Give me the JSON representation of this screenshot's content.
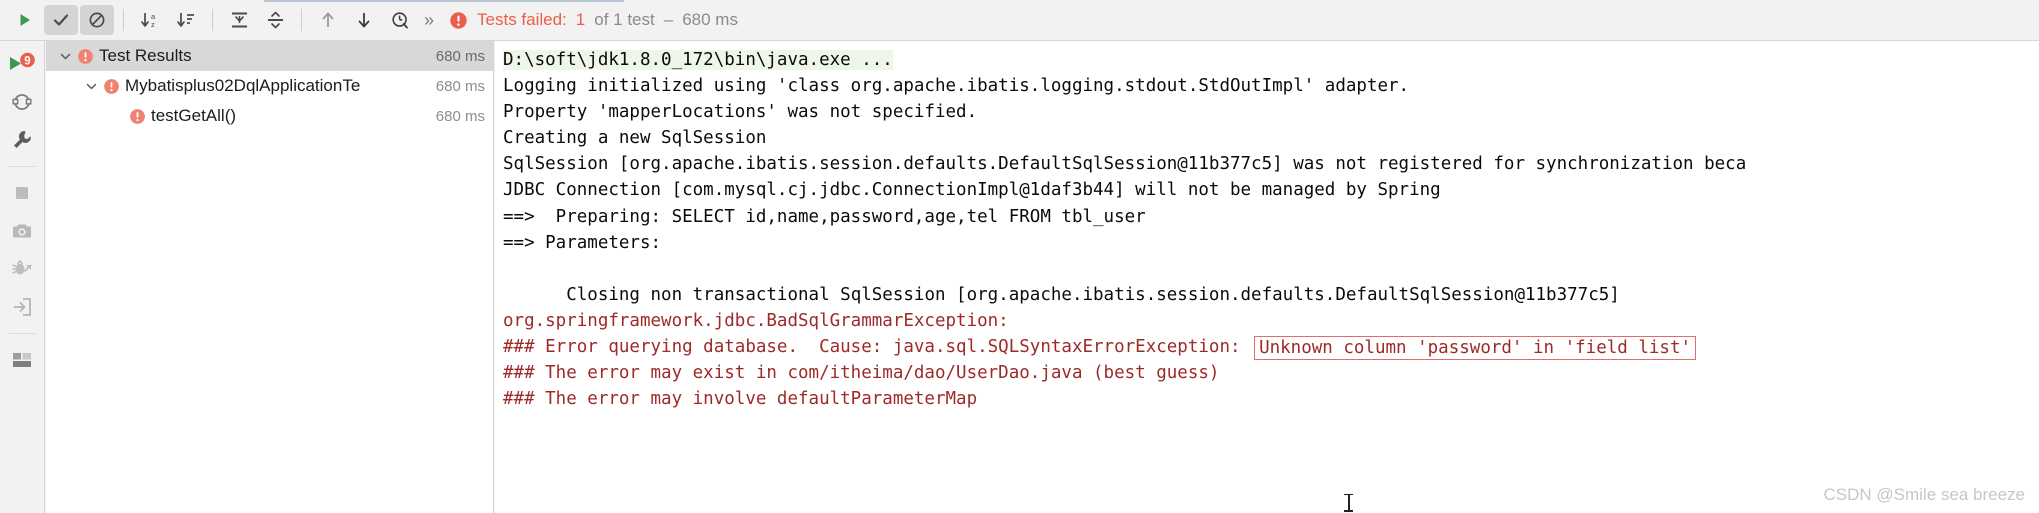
{
  "toolbar": {
    "buttons": [
      {
        "name": "rerun-tests-button",
        "icon": "play-icon",
        "label": "Rerun Tests",
        "pressed": false
      },
      {
        "name": "show-passed-button",
        "icon": "check-icon",
        "label": "Show Passed",
        "pressed": true
      },
      {
        "name": "show-ignored-button",
        "icon": "ignore-icon",
        "label": "Show Ignored",
        "pressed": true
      },
      {
        "name": "sort-alphabetically-button",
        "icon": "sort-alpha-icon",
        "label": "Sort Alphabetically",
        "pressed": false
      },
      {
        "name": "sort-by-duration-button",
        "icon": "sort-duration-icon",
        "label": "Sort by Duration",
        "pressed": false
      },
      {
        "name": "expand-all-button",
        "icon": "expand-all-icon",
        "label": "Expand All",
        "pressed": false
      },
      {
        "name": "collapse-all-button",
        "icon": "collapse-all-icon",
        "label": "Collapse All",
        "pressed": false
      },
      {
        "name": "prev-failed-button",
        "icon": "arrow-up-icon",
        "label": "Previous Failed Test",
        "pressed": false
      },
      {
        "name": "next-failed-button",
        "icon": "arrow-down-icon",
        "label": "Next Failed Test",
        "pressed": false
      },
      {
        "name": "test-history-button",
        "icon": "history-clock-icon",
        "label": "Test History",
        "pressed": false
      }
    ],
    "more_label": "»",
    "status": {
      "icon": "error-circle-icon",
      "failed_text": "Tests failed:",
      "count": "1",
      "of_text": "of 1 test",
      "separator": "–",
      "duration": "680 ms"
    }
  },
  "sidestrip": {
    "items": [
      {
        "name": "run-tool-window-button",
        "icon": "run-badge-9-icon",
        "badge": "9"
      },
      {
        "name": "rerun-failed-button",
        "icon": "rerun-circular-icon"
      },
      {
        "name": "settings-wrench-button",
        "icon": "wrench-icon"
      },
      {
        "name": "divider-1",
        "icon": "divider"
      },
      {
        "name": "stop-button",
        "icon": "stop-square-icon"
      },
      {
        "name": "screenshot-button",
        "icon": "camera-icon"
      },
      {
        "name": "debug-export-button",
        "icon": "bug-export-icon"
      },
      {
        "name": "import-button",
        "icon": "import-arrow-icon"
      },
      {
        "name": "divider-2",
        "icon": "divider"
      },
      {
        "name": "layout-button",
        "icon": "layout-icon"
      }
    ]
  },
  "tree": {
    "rows": [
      {
        "name": "tree-row-test-results",
        "label": "Test Results",
        "time": "680 ms",
        "indent": 0,
        "expanded": true,
        "selected": true,
        "status": "failed"
      },
      {
        "name": "tree-row-test-class",
        "label": "Mybatisplus02DqlApplicationTe",
        "time": "680 ms",
        "indent": 1,
        "expanded": true,
        "selected": false,
        "status": "failed"
      },
      {
        "name": "tree-row-test-method",
        "label": "testGetAll()",
        "time": "680 ms",
        "indent": 2,
        "expanded": null,
        "selected": false,
        "status": "failed"
      }
    ]
  },
  "console": {
    "lines": [
      {
        "text": "D:\\soft\\jdk1.8.0_172\\bin\\java.exe ...",
        "highlight": true,
        "red": false
      },
      {
        "text": "Logging initialized using 'class org.apache.ibatis.logging.stdout.StdOutImpl' adapter.",
        "highlight": false,
        "red": false
      },
      {
        "text": "Property 'mapperLocations' was not specified.",
        "highlight": false,
        "red": false
      },
      {
        "text": "Creating a new SqlSession",
        "highlight": false,
        "red": false
      },
      {
        "text": "SqlSession [org.apache.ibatis.session.defaults.DefaultSqlSession@11b377c5] was not registered for synchronization beca",
        "highlight": false,
        "red": false
      },
      {
        "text": "JDBC Connection [com.mysql.cj.jdbc.ConnectionImpl@1daf3b44] will not be managed by Spring",
        "highlight": false,
        "red": false
      },
      {
        "text": "==>  Preparing: SELECT id,name,password,age,tel FROM tbl_user",
        "highlight": false,
        "red": false
      },
      {
        "text": "==> Parameters:",
        "highlight": false,
        "red": false
      },
      {
        "text": "Closing non transactional SqlSession [org.apache.ibatis.session.defaults.DefaultSqlSession@11b377c5]",
        "highlight": false,
        "red": false
      },
      {
        "text": "",
        "highlight": false,
        "red": false
      },
      {
        "text": "org.springframework.jdbc.BadSqlGrammarException:",
        "highlight": false,
        "red": true
      },
      {
        "text": "### Error querying database.  Cause: java.sql.SQLSyntaxErrorException: ",
        "highlight": false,
        "red": true,
        "boxed": "Unknown column 'password' in 'field list'"
      },
      {
        "text": "### The error may exist in com/itheima/dao/UserDao.java (best guess)",
        "highlight": false,
        "red": true
      },
      {
        "text": "### The error may involve defaultParameterMap",
        "highlight": false,
        "red": true
      }
    ]
  },
  "watermark": {
    "text": "CSDN @Smile sea breeze"
  }
}
